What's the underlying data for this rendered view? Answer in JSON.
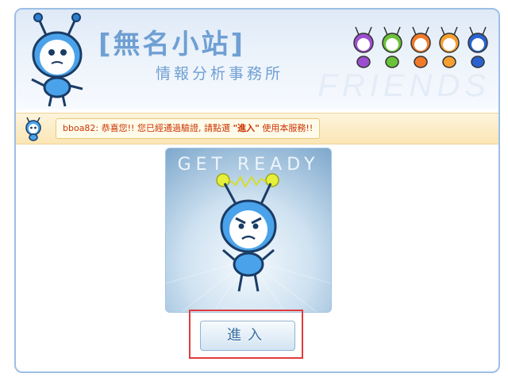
{
  "header": {
    "title": "[無名小站]",
    "subtitle": "情報分析事務所",
    "watermark": "FRIENDS"
  },
  "notice": {
    "username": "bboa82:",
    "message_part1": " 恭喜您!! 您已經通過驗證, 請點選 ",
    "enter_word": "\"進入\"",
    "message_part2": " 使用本服務!!"
  },
  "card": {
    "title": "GET READY"
  },
  "enter_button": {
    "label": "進入"
  },
  "colors": {
    "accent": "#6f9fd3",
    "notice_text": "#cc3300",
    "highlight": "#e23b3b"
  },
  "mini_bots": [
    "purple",
    "green",
    "orange",
    "orange",
    "blue"
  ]
}
